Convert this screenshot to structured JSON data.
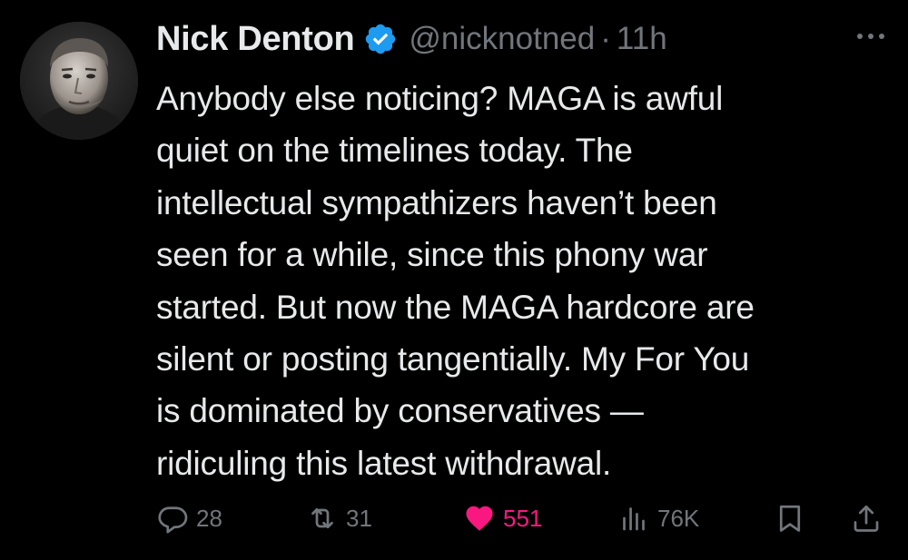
{
  "tweet": {
    "author": {
      "display_name": "Nick Denton",
      "handle": "@nicknotned",
      "verified": true
    },
    "separator": "·",
    "time": "11h",
    "text": "Anybody else noticing? MAGA is awful\nquiet on the timelines today. The\nintellectual sympathizers haven’t been\nseen for a while, since this phony war\nstarted. But now the MAGA hardcore are\nsilent or posting tangentially. My For You\nis dominated by conservatives —\nridiculing this latest withdrawal.",
    "actions": {
      "replies": "28",
      "reposts": "31",
      "likes": "551",
      "views": "76K"
    },
    "liked": true
  },
  "icons": {
    "verified": "verified-badge-icon",
    "more": "more-dots-icon",
    "reply": "reply-bubble-icon",
    "repost": "repost-arrows-icon",
    "like": "heart-icon",
    "views": "bar-chart-icon",
    "bookmark": "bookmark-icon",
    "share": "share-upload-icon"
  },
  "colors": {
    "background": "#000000",
    "text_primary": "#e7e9ea",
    "text_secondary": "#71767b",
    "verified_blue": "#1d9bf0",
    "like_pink": "#f91880"
  }
}
